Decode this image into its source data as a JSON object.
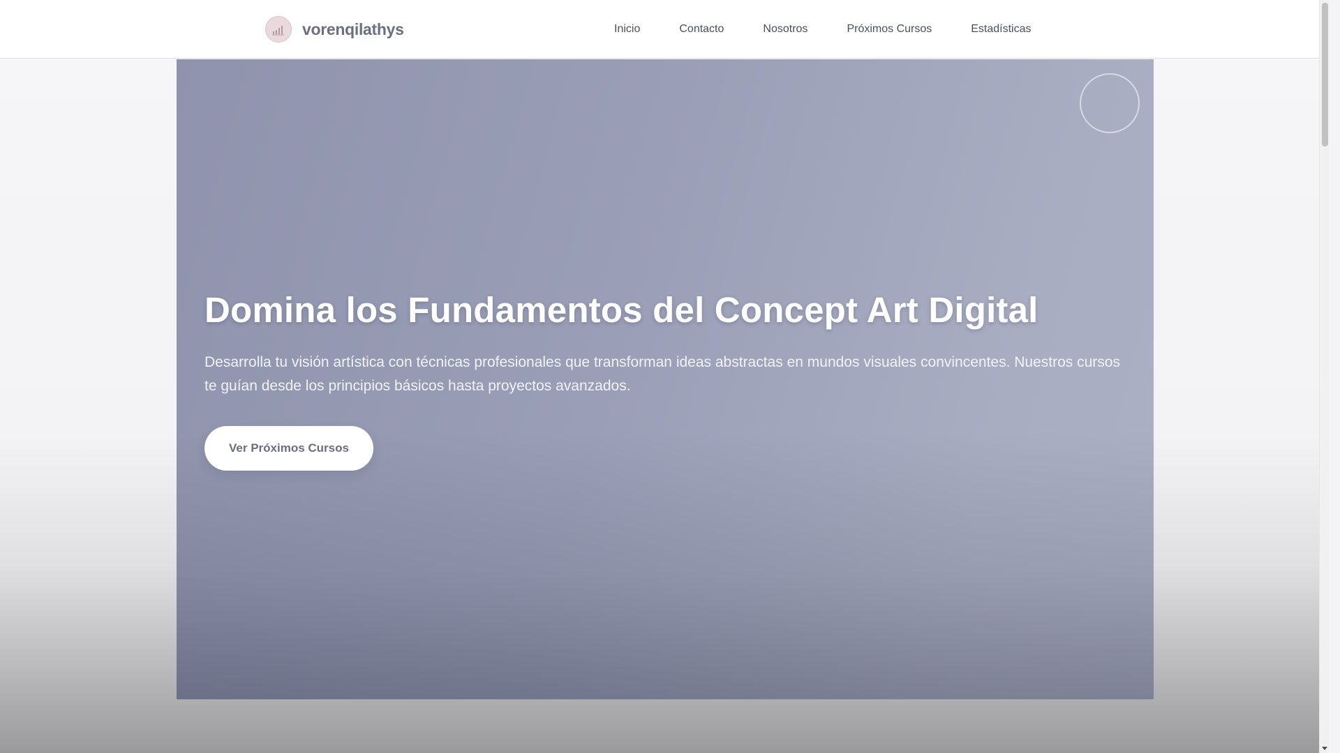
{
  "brand": {
    "name": "vorenqilathys",
    "logo_icon": "bar-chart-logo-icon"
  },
  "nav": {
    "items": [
      {
        "label": "Inicio"
      },
      {
        "label": "Contacto"
      },
      {
        "label": "Nosotros"
      },
      {
        "label": "Próximos Cursos"
      },
      {
        "label": "Estadísticas"
      }
    ]
  },
  "hero": {
    "title": "Domina los Fundamentos del Concept Art Digital",
    "description": "Desarrolla tu visión artística con técnicas profesionales que transforman ideas abstractas en mundos visuales convincentes. Nuestros cursos te guían desde los principios básicos hasta proyectos avanzados.",
    "cta_label": "Ver Próximos Cursos",
    "decorative_icon": "circle-outline-icon"
  },
  "colors": {
    "hero_gradient_start": "#8f93ad",
    "hero_gradient_end": "#acb0c4",
    "brand_text": "#6b6f80",
    "nav_text": "#4a4e5e",
    "button_text": "#6a6e84",
    "logo_bg": "#eadadd"
  }
}
